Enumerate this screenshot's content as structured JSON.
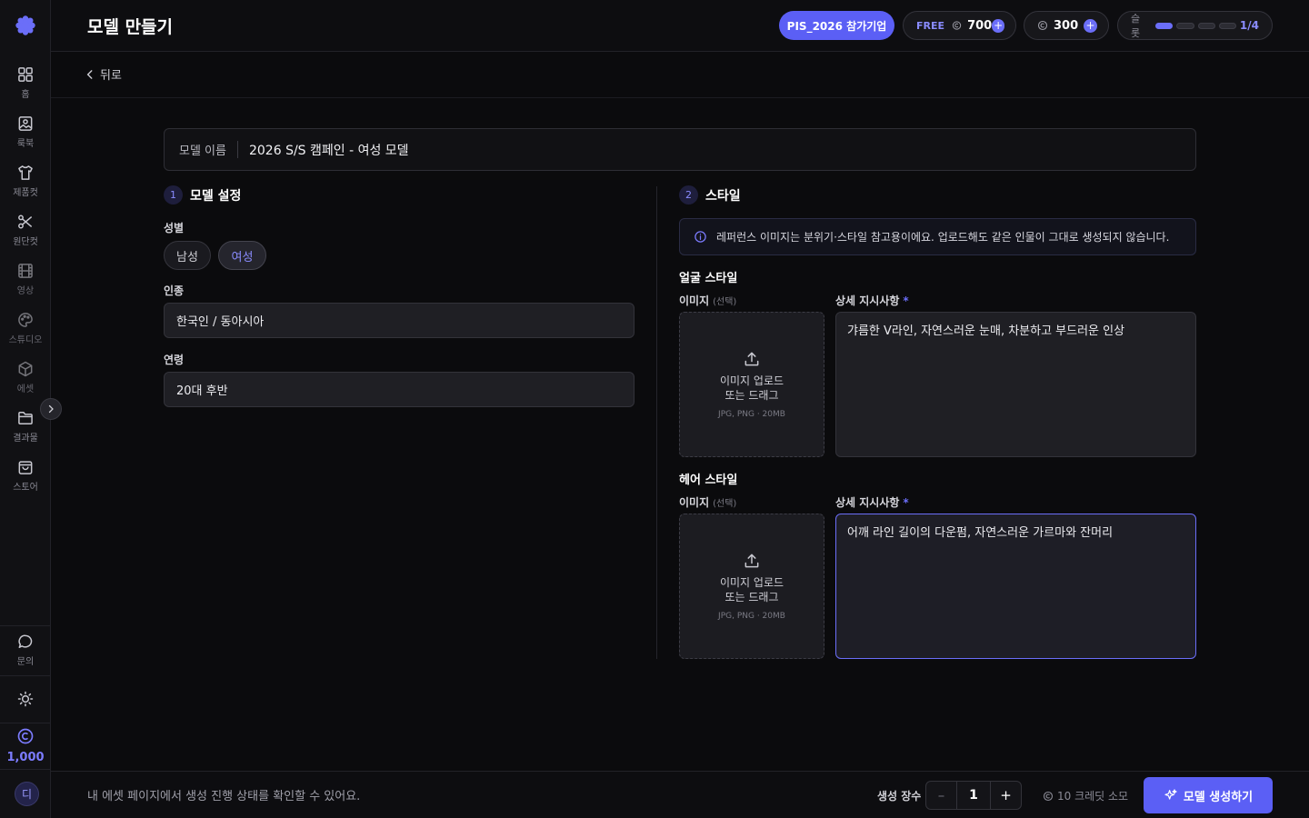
{
  "header": {
    "title": "모델 만들기",
    "join_badge": "PIS_2026 참가기업",
    "free_label": "FREE",
    "free_credits": "700",
    "credits": "300",
    "slot_label": "슬롯",
    "slot_count": "1/4",
    "slot_fill": 0.25
  },
  "sidebar": {
    "items": [
      {
        "label": "홈",
        "icon": "home-grid-icon"
      },
      {
        "label": "룩북",
        "icon": "image-icon"
      },
      {
        "label": "제품컷",
        "icon": "shirt-icon"
      },
      {
        "label": "원단컷",
        "icon": "scissors-icon"
      },
      {
        "label": "영상",
        "icon": "film-icon"
      },
      {
        "label": "스튜디오",
        "icon": "palette-icon"
      },
      {
        "label": "에셋",
        "icon": "cube-icon"
      },
      {
        "label": "결과물",
        "icon": "folder-icon"
      },
      {
        "label": "스토어",
        "icon": "bag-icon"
      }
    ],
    "support_label": "문의",
    "credit_balance": "1,000",
    "avatar_initial": "디"
  },
  "back": {
    "label": "뒤로"
  },
  "model_name": {
    "label": "모델 이름",
    "value": "2026 S/S 캠페인 - 여성 모델"
  },
  "section1": {
    "step": "1",
    "title": "모델 설정",
    "gender_label": "성별",
    "gender_options": [
      "남성",
      "여성"
    ],
    "gender_selected": "여성",
    "race_label": "인종",
    "race_value": "한국인 / 동아시아",
    "age_label": "연령",
    "age_value": "20대 후반"
  },
  "section2": {
    "step": "2",
    "title": "스타일",
    "info": "레퍼런스 이미지는 분위기·스타일 참고용이에요. 업로드해도 같은 인물이 그대로 생성되지 않습니다.",
    "face": {
      "title": "얼굴 스타일",
      "image_label": "이미지",
      "image_optional": "(선택)",
      "detail_label": "상세 지시사항",
      "required_mark": "*",
      "upload_line1": "이미지 업로드",
      "upload_line2": "또는 드래그",
      "upload_hint": "JPG, PNG · 20MB",
      "detail_value": "갸름한 V라인, 자연스러운 눈매, 차분하고 부드러운 인상"
    },
    "hair": {
      "title": "헤어 스타일",
      "image_label": "이미지",
      "image_optional": "(선택)",
      "detail_label": "상세 지시사항",
      "required_mark": "*",
      "upload_line1": "이미지 업로드",
      "upload_line2": "또는 드래그",
      "upload_hint": "JPG, PNG · 20MB",
      "detail_value": "어깨 라인 길이의 다운펌, 자연스러운 가르마와 잔머리"
    }
  },
  "footer": {
    "note": "내 에셋 페이지에서 생성 진행 상태를 확인할 수 있어요.",
    "qty_label": "생성 장수",
    "qty_value": "1",
    "cost": "10 크레딧 소모",
    "cta": "모델 생성하기"
  },
  "colors": {
    "accent": "#5b5ff5",
    "background": "#0b0b0d"
  }
}
